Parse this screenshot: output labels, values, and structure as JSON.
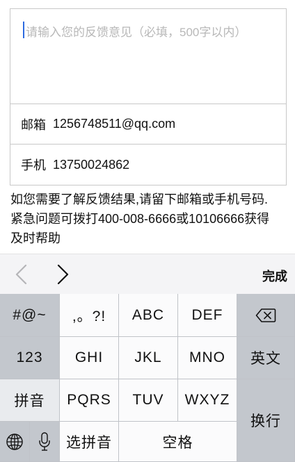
{
  "form": {
    "feedback_placeholder": "请输入您的反馈意见（必填，500字以内）",
    "email_label": "邮箱",
    "email_value": "1256748511@qq.com",
    "phone_label": "手机",
    "phone_value": "13750024862"
  },
  "hint": {
    "line1": "如您需要了解反馈结果,请留下邮箱或手机号码.",
    "line2": "紧急问题可拨打400-008-6666或10106666获得",
    "line3": "及时帮助"
  },
  "toolbar": {
    "done_label": "完成"
  },
  "keyboard": {
    "symbols": "#@~",
    "punct": ",。?!",
    "abc": "ABC",
    "def": "DEF",
    "num": "123",
    "ghi": "GHI",
    "jkl": "JKL",
    "mno": "MNO",
    "english": "英文",
    "pinyin": "拼音",
    "pqrs": "PQRS",
    "tuv": "TUV",
    "wxyz": "WXYZ",
    "return": "换行",
    "choose_pinyin": "选拼音",
    "space": "空格"
  },
  "colors": {
    "caret": "#2d6be0",
    "placeholder": "#b8b8b8",
    "keyboard_bg": "#c8ccd2",
    "key_light": "#fbfbfc",
    "key_dark": "#c3c7cd"
  }
}
